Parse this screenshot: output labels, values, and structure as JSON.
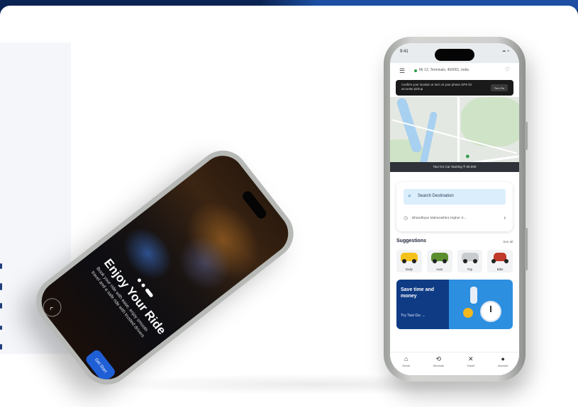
{
  "onboarding": {
    "title": "Enjoy Your Ride",
    "subtitle": "Book your ride with ease, enjoy smooth travel and a safe ride with trusted drivers",
    "cta": "Get Start",
    "back_icon": "arrow-left-icon"
  },
  "home": {
    "status": {
      "time": "9:41",
      "icons": "▪▪ ◔"
    },
    "address": "Mr 12, Terminals, 400001, India",
    "permission": {
      "text": "Confirm your location or turn on your phone GPS for accurate pickup",
      "button": "Turn On"
    },
    "starting_banner": "Taxi Go Car Starting ₹ 60,000",
    "search_placeholder": "Search Destination",
    "recent": "Bhandhiyar Maharashtra Higher S...",
    "suggestions_title": "Suggestions",
    "see_all": "See all",
    "suggestions": [
      {
        "label": "Daily",
        "color": "#f4c21b"
      },
      {
        "label": "Auto",
        "color": "#5b8f2e"
      },
      {
        "label": "Trip",
        "color": "#c9cccf"
      },
      {
        "label": "Bike",
        "color": "#c0392b"
      }
    ],
    "promo": {
      "title": "Save time and money",
      "link": "Try Taxi Go →"
    },
    "nav": [
      {
        "label": "Home",
        "icon": "home-icon"
      },
      {
        "label": "Services",
        "icon": "services-icon"
      },
      {
        "label": "Travel",
        "icon": "travel-icon"
      },
      {
        "label": "Account",
        "icon": "account-icon"
      }
    ]
  }
}
